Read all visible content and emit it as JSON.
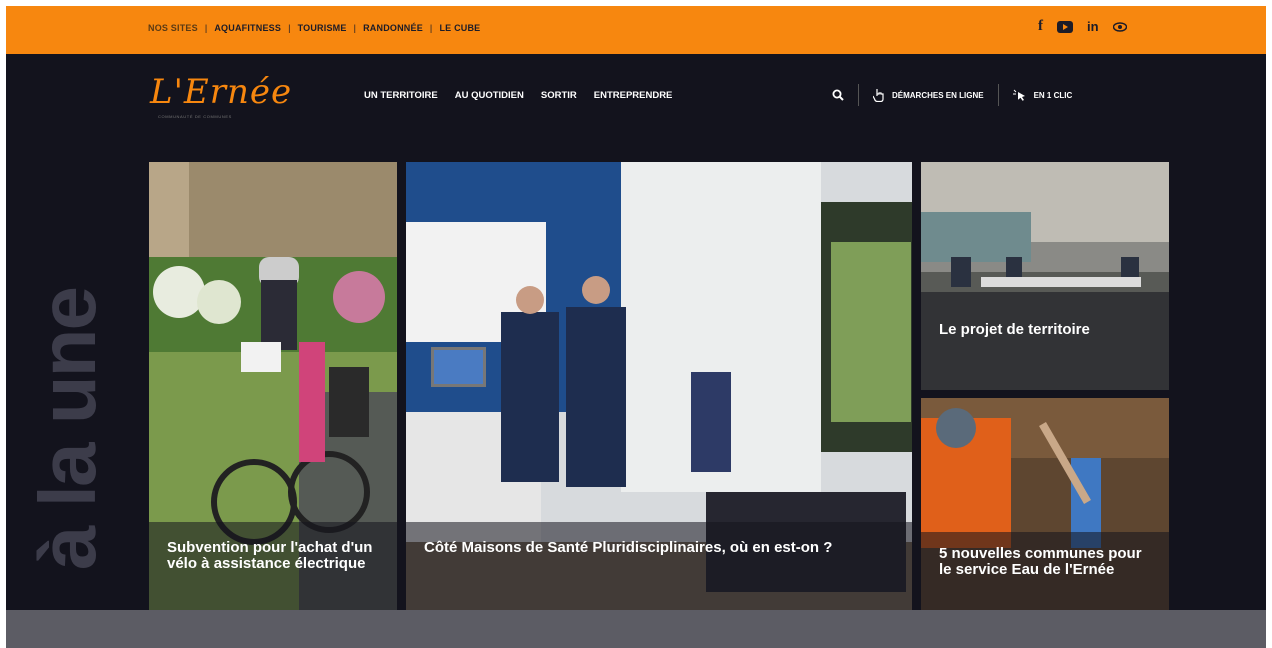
{
  "topbar": {
    "links": [
      "NOS SITES",
      "AQUAFITNESS",
      "TOURISME",
      "RANDONNÉE",
      "LE CUBE"
    ],
    "socials": [
      {
        "icon": "facebook-icon",
        "glyph": "f"
      },
      {
        "icon": "youtube-icon",
        "glyph": "▶"
      },
      {
        "icon": "linkedin-icon",
        "glyph": "in"
      },
      {
        "icon": "eye-icon",
        "glyph": "◉"
      }
    ]
  },
  "header": {
    "logo_text": "L'Ernée",
    "logo_sub": "COMMUNAUTÉ DE COMMUNES",
    "nav": [
      "UN TERRITOIRE",
      "AU QUOTIDIEN",
      "SORTIR",
      "ENTREPRENDRE"
    ],
    "demarches_label": "DÉMARCHES EN LIGNE",
    "clic_label": "EN 1 CLIC"
  },
  "section_title": "à la une",
  "cards": [
    {
      "caption": "Subvention pour l'achat d'un vélo à assistance électrique"
    },
    {
      "caption": "Côté Maisons de Santé Pluridisciplinaires, où en est-on ?"
    },
    {
      "caption": "Le projet de territoire"
    },
    {
      "caption": "5 nouvelles communes pour le service Eau de l'Ernée"
    }
  ],
  "colors": {
    "accent": "#f7870f",
    "dark": "#13131d",
    "footer_grey": "#5c5c64"
  }
}
